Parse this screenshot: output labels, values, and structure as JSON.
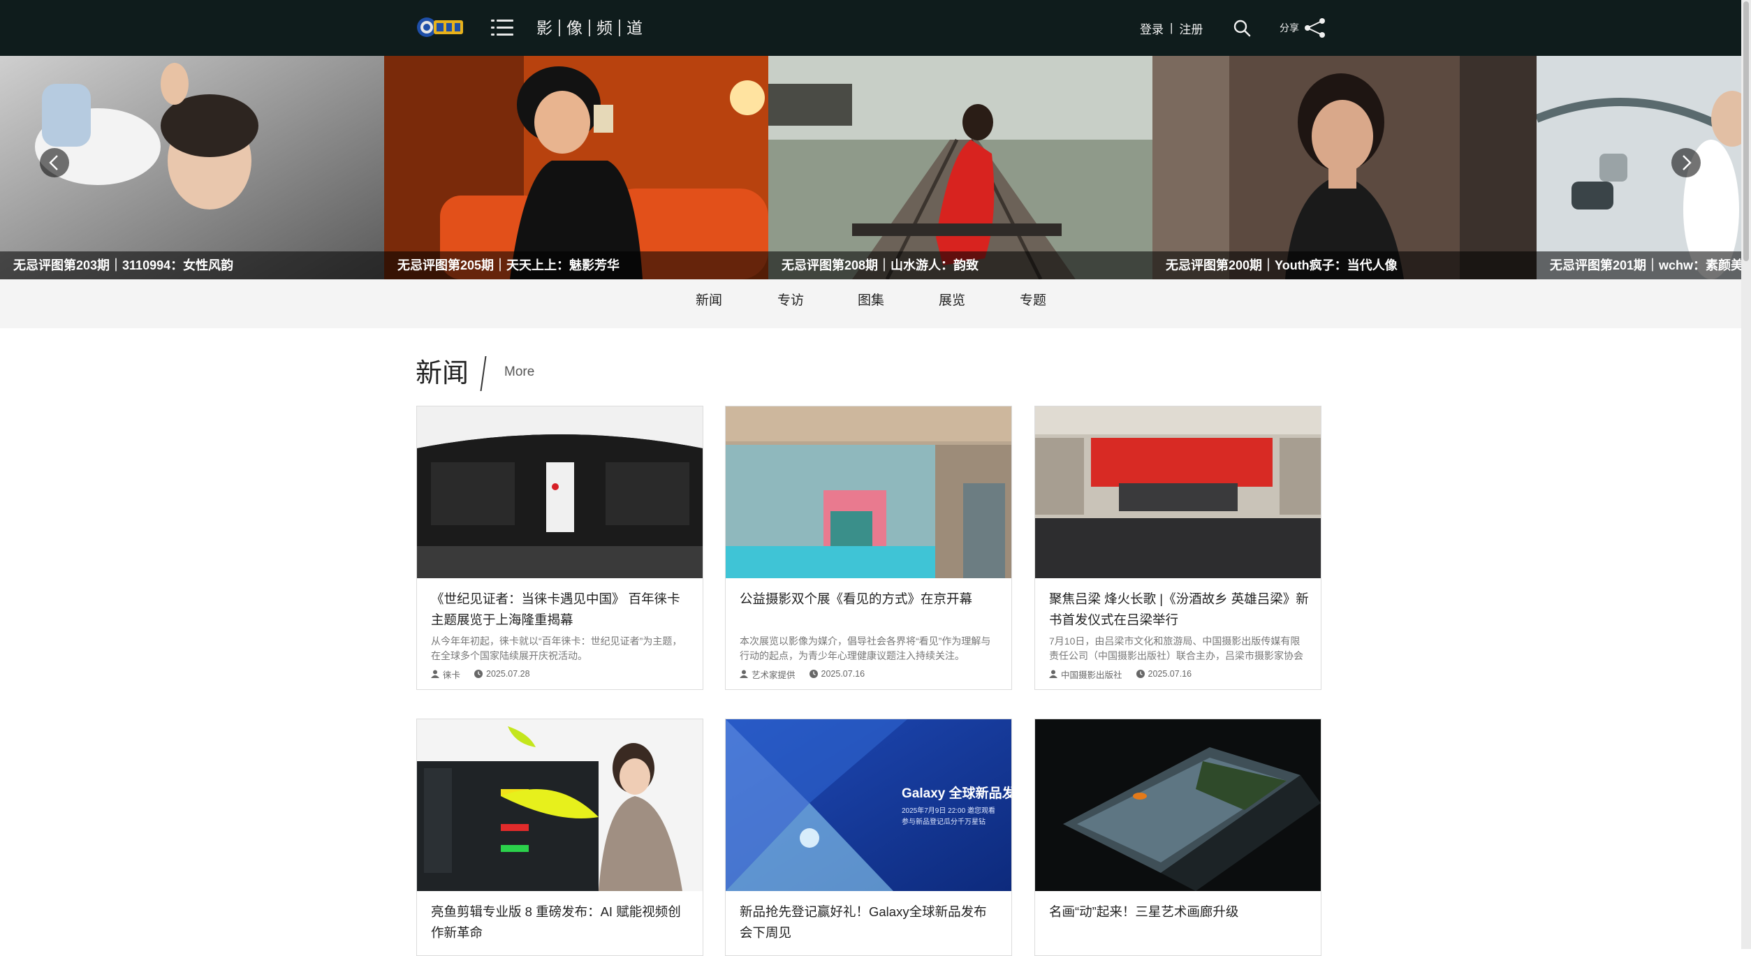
{
  "header": {
    "channel_chars": [
      "影",
      "像",
      "频",
      "道"
    ],
    "login_label": "登录",
    "separator": "|",
    "register_label": "注册",
    "share_label": "分享"
  },
  "slider": {
    "slides": [
      {
        "caption": "无忌评图第203期｜3110994：女性风韵"
      },
      {
        "caption": "无忌评图第205期｜天天上上：魅影芳华"
      },
      {
        "caption": "无忌评图第208期｜山水游人：韵致"
      },
      {
        "caption": "无忌评图第200期｜Youth疯子：当代人像"
      },
      {
        "caption": "无忌评图第201期｜wchw：素颜美"
      }
    ]
  },
  "subnav": {
    "items": [
      "新闻",
      "专访",
      "图集",
      "展览",
      "专题"
    ]
  },
  "news": {
    "title": "新闻",
    "more_label": "More",
    "cards": [
      {
        "title": "《世纪见证者：当徕卡遇见中国》 百年徕卡主题展览于上海隆重揭幕",
        "desc": "从今年年初起，徕卡就以“百年徕卡：世纪见证者”为主题，在全球多个国家陆续展开庆祝活动。",
        "author": "徕卡",
        "date": "2025.07.28"
      },
      {
        "title": "公益摄影双个展《看见的方式》在京开幕",
        "desc": "本次展览以影像为媒介，倡导社会各界将“看见”作为理解与行动的起点，为青少年心理健康议题注入持续关注。",
        "author": "艺术家提供",
        "date": "2025.07.16"
      },
      {
        "title": "聚焦吕梁 烽火长歌 |《汾酒故乡 英雄吕梁》新书首发仪式在吕梁举行",
        "desc": "7月10日，由吕梁市文化和旅游局、中国摄影出版传媒有限责任公司（中国摄影出版社）联合主办，吕梁市摄影家协会",
        "author": "中国摄影出版社",
        "date": "2025.07.16"
      },
      {
        "title": "亮鱼剪辑专业版 8 重磅发布：AI 赋能视频创作新革命",
        "desc": "",
        "author": "",
        "date": ""
      },
      {
        "title": "新品抢先登记赢好礼！Galaxy全球新品发布会下周见",
        "desc": "",
        "author": "",
        "date": "",
        "thumb_text": [
          "Galaxy 全球新品发",
          "2025年7月9日 22:00 邀您观看",
          "参与新品登记瓜分千万星钻"
        ]
      },
      {
        "title": "名画“动”起来！三星艺术画廊升级",
        "desc": "",
        "author": "",
        "date": ""
      }
    ]
  }
}
